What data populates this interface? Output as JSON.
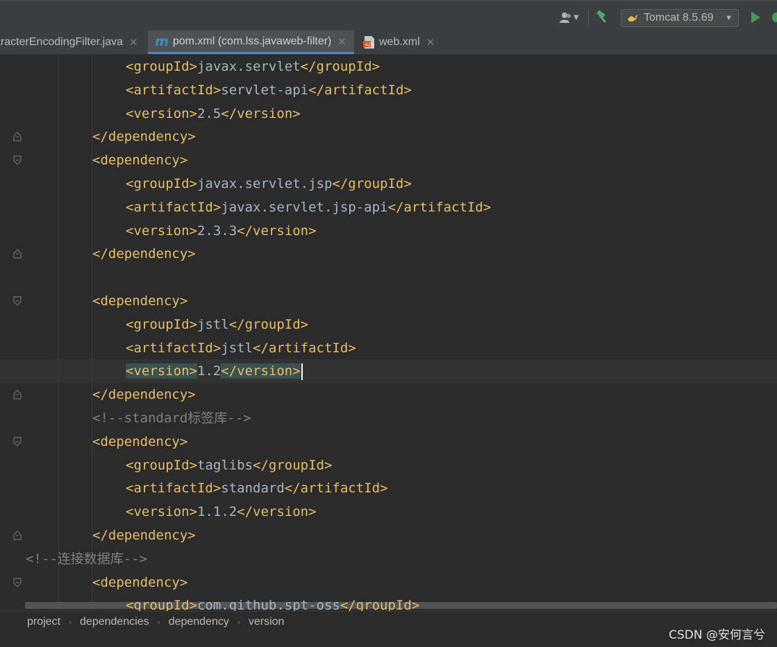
{
  "toolbar": {
    "run_config_label": "Tomcat 8.5.69",
    "icons": [
      "user-icon",
      "hammer-icon",
      "tomcat-icon",
      "run-icon",
      "debug-icon"
    ]
  },
  "tabs": [
    {
      "label": "aracterEncodingFilter.java",
      "icon": "java-file-icon",
      "active": false
    },
    {
      "label": "pom.xml (com.lss.javaweb-filter)",
      "icon": "maven-icon",
      "active": true
    },
    {
      "label": "web.xml",
      "icon": "xml-file-icon",
      "active": false
    }
  ],
  "editor": {
    "lines": [
      {
        "indent": 3,
        "tokens": [
          {
            "c": "tag",
            "t": "<groupId>"
          },
          {
            "c": "txt",
            "t": "javax.servlet"
          },
          {
            "c": "tag",
            "t": "</groupId>"
          }
        ]
      },
      {
        "indent": 3,
        "tokens": [
          {
            "c": "tag",
            "t": "<artifactId>"
          },
          {
            "c": "txt",
            "t": "servlet-api"
          },
          {
            "c": "tag",
            "t": "</artifactId>"
          }
        ]
      },
      {
        "indent": 3,
        "tokens": [
          {
            "c": "tag",
            "t": "<version>"
          },
          {
            "c": "txt",
            "t": "2.5"
          },
          {
            "c": "tag",
            "t": "</version>"
          }
        ]
      },
      {
        "indent": 2,
        "fold": "end",
        "tokens": [
          {
            "c": "tag",
            "t": "</dependency>"
          }
        ]
      },
      {
        "indent": 2,
        "fold": "start",
        "tokens": [
          {
            "c": "tag",
            "t": "<dependency>"
          }
        ]
      },
      {
        "indent": 3,
        "tokens": [
          {
            "c": "tag",
            "t": "<groupId>"
          },
          {
            "c": "txt",
            "t": "javax.servlet.jsp"
          },
          {
            "c": "tag",
            "t": "</groupId>"
          }
        ]
      },
      {
        "indent": 3,
        "tokens": [
          {
            "c": "tag",
            "t": "<artifactId>"
          },
          {
            "c": "txt",
            "t": "javax.servlet.jsp-api"
          },
          {
            "c": "tag",
            "t": "</artifactId>"
          }
        ]
      },
      {
        "indent": 3,
        "tokens": [
          {
            "c": "tag",
            "t": "<version>"
          },
          {
            "c": "txt",
            "t": "2.3.3"
          },
          {
            "c": "tag",
            "t": "</version>"
          }
        ]
      },
      {
        "indent": 2,
        "fold": "end",
        "tokens": [
          {
            "c": "tag",
            "t": "</dependency>"
          }
        ]
      },
      {
        "indent": 0,
        "tokens": []
      },
      {
        "indent": 2,
        "fold": "start",
        "tokens": [
          {
            "c": "tag",
            "t": "<dependency>"
          }
        ]
      },
      {
        "indent": 3,
        "tokens": [
          {
            "c": "tag",
            "t": "<groupId>"
          },
          {
            "c": "txt",
            "t": "jstl"
          },
          {
            "c": "tag",
            "t": "</groupId>"
          }
        ]
      },
      {
        "indent": 3,
        "tokens": [
          {
            "c": "tag",
            "t": "<artifactId>"
          },
          {
            "c": "txt",
            "t": "jstl"
          },
          {
            "c": "tag",
            "t": "</artifactId>"
          }
        ]
      },
      {
        "indent": 3,
        "current": true,
        "tokens": [
          {
            "c": "tag hl",
            "t": "<version>"
          },
          {
            "c": "txt",
            "t": "1.2"
          },
          {
            "c": "tag hl",
            "t": "</version>"
          }
        ]
      },
      {
        "indent": 2,
        "fold": "end",
        "tokens": [
          {
            "c": "tag",
            "t": "</dependency>"
          }
        ]
      },
      {
        "indent": 2,
        "tokens": [
          {
            "c": "cmt",
            "t": "<!--standard标签库-->"
          }
        ]
      },
      {
        "indent": 2,
        "fold": "start",
        "tokens": [
          {
            "c": "tag",
            "t": "<dependency>"
          }
        ]
      },
      {
        "indent": 3,
        "tokens": [
          {
            "c": "tag",
            "t": "<groupId>"
          },
          {
            "c": "txt",
            "t": "taglibs"
          },
          {
            "c": "tag",
            "t": "</groupId>"
          }
        ]
      },
      {
        "indent": 3,
        "tokens": [
          {
            "c": "tag",
            "t": "<artifactId>"
          },
          {
            "c": "txt",
            "t": "standard"
          },
          {
            "c": "tag",
            "t": "</artifactId>"
          }
        ]
      },
      {
        "indent": 3,
        "tokens": [
          {
            "c": "tag",
            "t": "<version>"
          },
          {
            "c": "txt",
            "t": "1.1.2"
          },
          {
            "c": "tag",
            "t": "</version>"
          }
        ]
      },
      {
        "indent": 2,
        "fold": "end",
        "tokens": [
          {
            "c": "tag",
            "t": "</dependency>"
          }
        ]
      },
      {
        "indent": -1,
        "tokens": [
          {
            "c": "cmt",
            "t": "<!--连接数据库-->"
          }
        ]
      },
      {
        "indent": 2,
        "fold": "start",
        "tokens": [
          {
            "c": "tag",
            "t": "<dependency>"
          }
        ]
      },
      {
        "indent": 3,
        "tokens": [
          {
            "c": "tag",
            "t": "<groupId>"
          },
          {
            "c": "txt",
            "t": "com.github.spt-oss"
          },
          {
            "c": "tag",
            "t": "</groupId>"
          }
        ]
      }
    ]
  },
  "breadcrumb": [
    "project",
    "dependencies",
    "dependency",
    "version"
  ],
  "watermark": "CSDN @安何言兮"
}
